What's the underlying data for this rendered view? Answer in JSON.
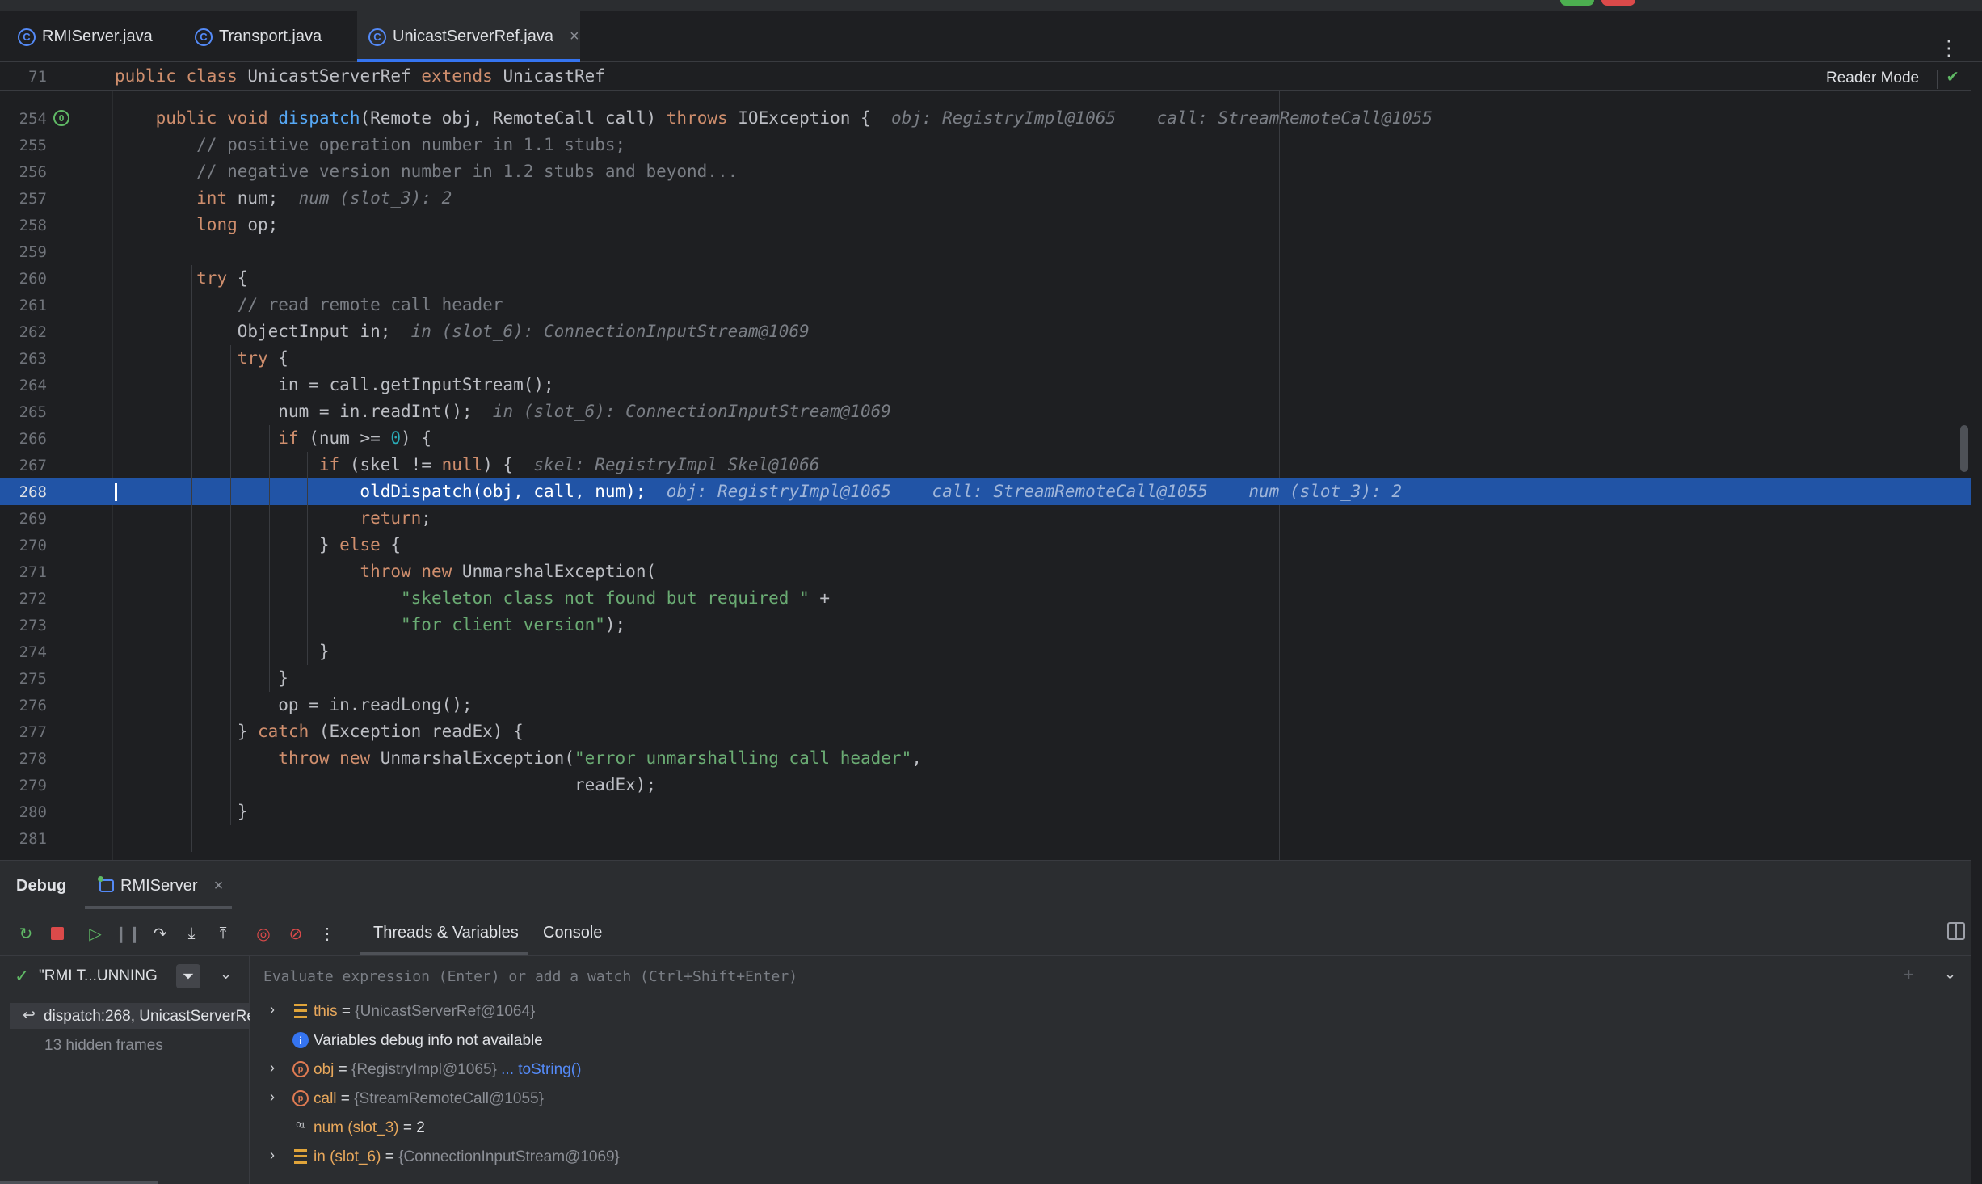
{
  "tabs": [
    {
      "label": "RMIServer.java"
    },
    {
      "label": "Transport.java"
    },
    {
      "label": "UnicastServerRef.java"
    }
  ],
  "editor": {
    "sticky_line": {
      "ln": "71",
      "code": "public class UnicastServerRef extends UnicastRef"
    },
    "reader_mode": "Reader Mode",
    "lines": [
      {
        "ln": "254",
        "code": "    public void dispatch(Remote obj, RemoteCall call) throws IOException {",
        "hint": "obj: RegistryImpl@1065    call: StreamRemoteCall@1055"
      },
      {
        "ln": "255",
        "code": "        // positive operation number in 1.1 stubs;",
        "hint": ""
      },
      {
        "ln": "256",
        "code": "        // negative version number in 1.2 stubs and beyond...",
        "hint": ""
      },
      {
        "ln": "257",
        "code": "        int num;",
        "hint": "num (slot_3): 2"
      },
      {
        "ln": "258",
        "code": "        long op;",
        "hint": ""
      },
      {
        "ln": "259",
        "code": "",
        "hint": ""
      },
      {
        "ln": "260",
        "code": "        try {",
        "hint": ""
      },
      {
        "ln": "261",
        "code": "            // read remote call header",
        "hint": ""
      },
      {
        "ln": "262",
        "code": "            ObjectInput in;",
        "hint": "in (slot_6): ConnectionInputStream@1069"
      },
      {
        "ln": "263",
        "code": "            try {",
        "hint": ""
      },
      {
        "ln": "264",
        "code": "                in = call.getInputStream();",
        "hint": ""
      },
      {
        "ln": "265",
        "code": "                num = in.readInt();",
        "hint": "in (slot_6): ConnectionInputStream@1069"
      },
      {
        "ln": "266",
        "code": "                if (num >= 0) {",
        "hint": ""
      },
      {
        "ln": "267",
        "code": "                    if (skel != null) {",
        "hint": "skel: RegistryImpl_Skel@1066"
      },
      {
        "ln": "268",
        "code": "                        oldDispatch(obj, call, num);",
        "hint": "obj: RegistryImpl@1065    call: StreamRemoteCall@1055    num (slot_3): 2"
      },
      {
        "ln": "269",
        "code": "                        return;",
        "hint": ""
      },
      {
        "ln": "270",
        "code": "                    } else {",
        "hint": ""
      },
      {
        "ln": "271",
        "code": "                        throw new UnmarshalException(",
        "hint": ""
      },
      {
        "ln": "272",
        "code": "                            \"skeleton class not found but required \" +",
        "hint": ""
      },
      {
        "ln": "273",
        "code": "                            \"for client version\");",
        "hint": ""
      },
      {
        "ln": "274",
        "code": "                    }",
        "hint": ""
      },
      {
        "ln": "275",
        "code": "                }",
        "hint": ""
      },
      {
        "ln": "276",
        "code": "                op = in.readLong();",
        "hint": ""
      },
      {
        "ln": "277",
        "code": "            } catch (Exception readEx) {",
        "hint": ""
      },
      {
        "ln": "278",
        "code": "                throw new UnmarshalException(\"error unmarshalling call header\",",
        "hint": ""
      },
      {
        "ln": "279",
        "code": "                                             readEx);",
        "hint": ""
      },
      {
        "ln": "280",
        "code": "            }",
        "hint": ""
      },
      {
        "ln": "281",
        "code": "",
        "hint": ""
      }
    ],
    "highlighted_line": "268"
  },
  "debug": {
    "title": "Debug",
    "session_tab": "RMIServer",
    "subtabs": [
      "Threads & Variables",
      "Console"
    ],
    "thread": "\"RMI T...UNNING",
    "frame": "dispatch:268, UnicastServerRef",
    "hidden_frames": "13 hidden frames",
    "eval_placeholder": "Evaluate expression (Enter) or add a watch (Ctrl+Shift+Enter)",
    "variables": [
      {
        "name": "this",
        "value": "{UnicastServerRef@1064}",
        "link": "",
        "icon": "list-icon",
        "expandable": true
      },
      {
        "name": "",
        "value": "",
        "text": "Variables debug info not available",
        "icon": "info-icon",
        "expandable": false
      },
      {
        "name": "obj",
        "value": "{RegistryImpl@1065}",
        "link": "... toString()",
        "icon": "parameter-icon",
        "expandable": true
      },
      {
        "name": "call",
        "value": "{StreamRemoteCall@1055}",
        "link": "",
        "icon": "parameter-icon",
        "expandable": true
      },
      {
        "name": "num (slot_3)",
        "value": "2",
        "link": "",
        "icon": "primitive-icon",
        "expandable": false
      },
      {
        "name": "in (slot_6)",
        "value": "{ConnectionInputStream@1069}",
        "link": "",
        "icon": "list-icon",
        "expandable": true
      }
    ]
  },
  "colors": {
    "accent": "#3574f0",
    "highlight_line": "#2154a6",
    "keyword": "#cf8e6d",
    "string": "#6aab73"
  }
}
